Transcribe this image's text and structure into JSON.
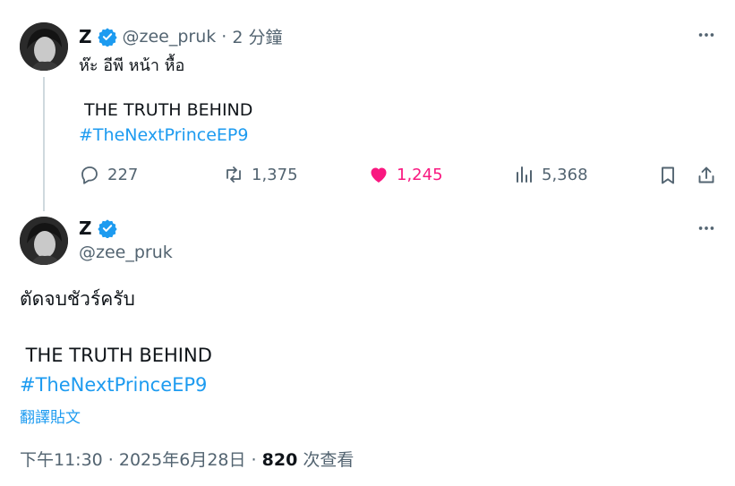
{
  "reply_tweet": {
    "author": {
      "name": "Z",
      "handle": "@zee_pruk",
      "time": "2 分鐘"
    },
    "line1": "ห๊ะ อีพี หน้า หื้อ",
    "line2": " THE TRUTH BEHIND",
    "hashtag": "#TheNextPrinceEP9",
    "stats": {
      "replies": "227",
      "retweets": "1,375",
      "likes": "1,245",
      "views": "5,368"
    },
    "colors": {
      "like": "#f91880",
      "link": "#1d9bf0",
      "verified": "#1d9bf0"
    }
  },
  "main_tweet": {
    "author": {
      "name": "Z",
      "handle": "@zee_pruk"
    },
    "line1": "ตัดจบชัวร์ครับ",
    "line2": " THE TRUTH BEHIND",
    "hashtag": "#TheNextPrinceEP9",
    "translate_label": "翻譯貼文",
    "timestamp": "下午11:30 · 2025年6月28日",
    "views_count": "820",
    "views_label": "次查看"
  },
  "icons": [
    "verified-icon",
    "more-icon",
    "reply-icon",
    "retweet-icon",
    "heart-icon",
    "views-icon",
    "bookmark-icon",
    "share-icon"
  ]
}
